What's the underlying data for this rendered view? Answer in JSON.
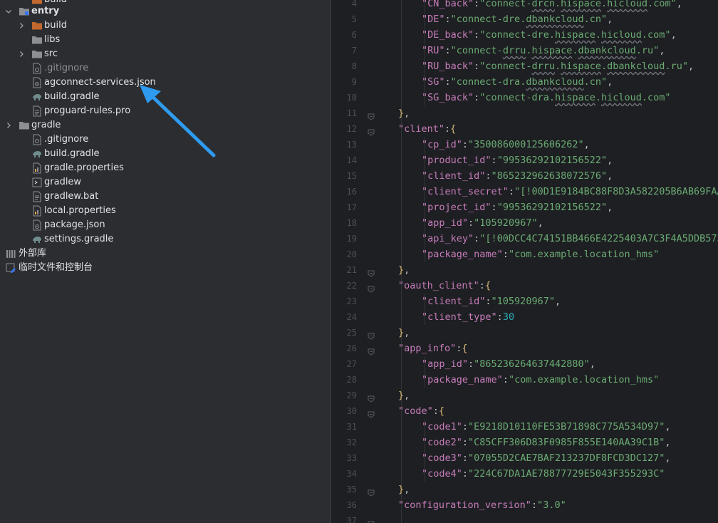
{
  "project_tree": {
    "items": [
      {
        "label": "build",
        "icon": "folder-orange-icon",
        "chevron": "none"
      },
      {
        "label": "entry",
        "icon": "module-folder-icon",
        "chevron": "expanded"
      },
      {
        "label": "build",
        "icon": "folder-orange-icon",
        "chevron": "collapsed"
      },
      {
        "label": "libs",
        "icon": "folder-icon",
        "chevron": "none"
      },
      {
        "label": "src",
        "icon": "folder-icon",
        "chevron": "collapsed"
      },
      {
        "label": ".gitignore",
        "icon": "gitignore-file-icon",
        "chevron": "none"
      },
      {
        "label": "agconnect-services.json",
        "icon": "json-file-icon",
        "chevron": "none"
      },
      {
        "label": "build.gradle",
        "icon": "gradle-elephant-icon",
        "chevron": "none"
      },
      {
        "label": "proguard-rules.pro",
        "icon": "text-file-icon",
        "chevron": "none"
      },
      {
        "label": "gradle",
        "icon": "folder-icon",
        "chevron": "collapsed"
      },
      {
        "label": ".gitignore",
        "icon": "gitignore-file-icon",
        "chevron": "none"
      },
      {
        "label": "build.gradle",
        "icon": "gradle-elephant-icon",
        "chevron": "none"
      },
      {
        "label": "gradle.properties",
        "icon": "properties-file-icon",
        "chevron": "none"
      },
      {
        "label": "gradlew",
        "icon": "terminal-file-icon",
        "chevron": "none"
      },
      {
        "label": "gradlew.bat",
        "icon": "text-file-icon",
        "chevron": "none"
      },
      {
        "label": "local.properties",
        "icon": "properties-file-icon",
        "chevron": "none"
      },
      {
        "label": "package.json",
        "icon": "json-file-icon",
        "chevron": "none"
      },
      {
        "label": "settings.gradle",
        "icon": "gradle-elephant-icon",
        "chevron": "none"
      },
      {
        "label": "外部库",
        "icon": "library-icon",
        "chevron": "none"
      },
      {
        "label": "临时文件和控制台",
        "icon": "scratches-icon",
        "chevron": "none"
      }
    ]
  },
  "editor": {
    "lines": [
      {
        "no": "4",
        "text": "\"CN_back\":\"connect-drcn.hispace.hicloud.com\","
      },
      {
        "no": "5",
        "text": "\"DE\":\"connect-dre.dbankcloud.cn\","
      },
      {
        "no": "6",
        "text": "\"DE_back\":\"connect-dre.hispace.hicloud.com\","
      },
      {
        "no": "7",
        "text": "\"RU\":\"connect-drru.hispace.dbankcloud.ru\","
      },
      {
        "no": "8",
        "text": "\"RU_back\":\"connect-drru.hispace.dbankcloud.ru\","
      },
      {
        "no": "9",
        "text": "\"SG\":\"connect-dra.dbankcloud.cn\","
      },
      {
        "no": "10",
        "text": "\"SG_back\":\"connect-dra.hispace.hicloud.com\""
      },
      {
        "no": "11",
        "text": "},"
      },
      {
        "no": "12",
        "text": "\"client\":{"
      },
      {
        "no": "13",
        "text": "\"cp_id\":\"350086000125606262\","
      },
      {
        "no": "14",
        "text": "\"product_id\":\"99536292102156522\","
      },
      {
        "no": "15",
        "text": "\"client_id\":\"865232962638072576\","
      },
      {
        "no": "16",
        "text": "\"client_secret\":\"[!00D1E9184BC88F8D3A582205B6AB69FAA"
      },
      {
        "no": "17",
        "text": "\"project_id\":\"99536292102156522\","
      },
      {
        "no": "18",
        "text": "\"app_id\":\"105920967\","
      },
      {
        "no": "19",
        "text": "\"api_key\":\"[!00DCC4C74151BB466E4225403A7C3F4A5DDB573"
      },
      {
        "no": "20",
        "text": "\"package_name\":\"com.example.location_hms\""
      },
      {
        "no": "21",
        "text": "},"
      },
      {
        "no": "22",
        "text": "\"oauth_client\":{"
      },
      {
        "no": "23",
        "text": "\"client_id\":\"105920967\","
      },
      {
        "no": "24",
        "text": "\"client_type\":30"
      },
      {
        "no": "25",
        "text": "},"
      },
      {
        "no": "26",
        "text": "\"app_info\":{"
      },
      {
        "no": "27",
        "text": "\"app_id\":\"865236264637442880\","
      },
      {
        "no": "28",
        "text": "\"package_name\":\"com.example.location_hms\""
      },
      {
        "no": "29",
        "text": "},"
      },
      {
        "no": "30",
        "text": "\"code\":{"
      },
      {
        "no": "31",
        "text": "\"code1\":\"E9218D10110FE53B71898C775A534D97\","
      },
      {
        "no": "32",
        "text": "\"code2\":\"C85CFF306D83F0985F855E140AA39C1B\","
      },
      {
        "no": "33",
        "text": "\"code3\":\"07055D2CAE7BAF213237DF8FCD3DC127\","
      },
      {
        "no": "34",
        "text": "\"code4\":\"224C67DA1AE78877729E5043F355293C\""
      },
      {
        "no": "35",
        "text": "},"
      },
      {
        "no": "36",
        "text": "\"configuration_version\":\"3.0\""
      },
      {
        "no": "37",
        "text": ""
      }
    ]
  },
  "colors": {
    "key": "#c77dbb",
    "string": "#6aab73",
    "number": "#2aacb8",
    "punct": "#bcbec4",
    "annotation_arrow": "#2f9bf0"
  }
}
